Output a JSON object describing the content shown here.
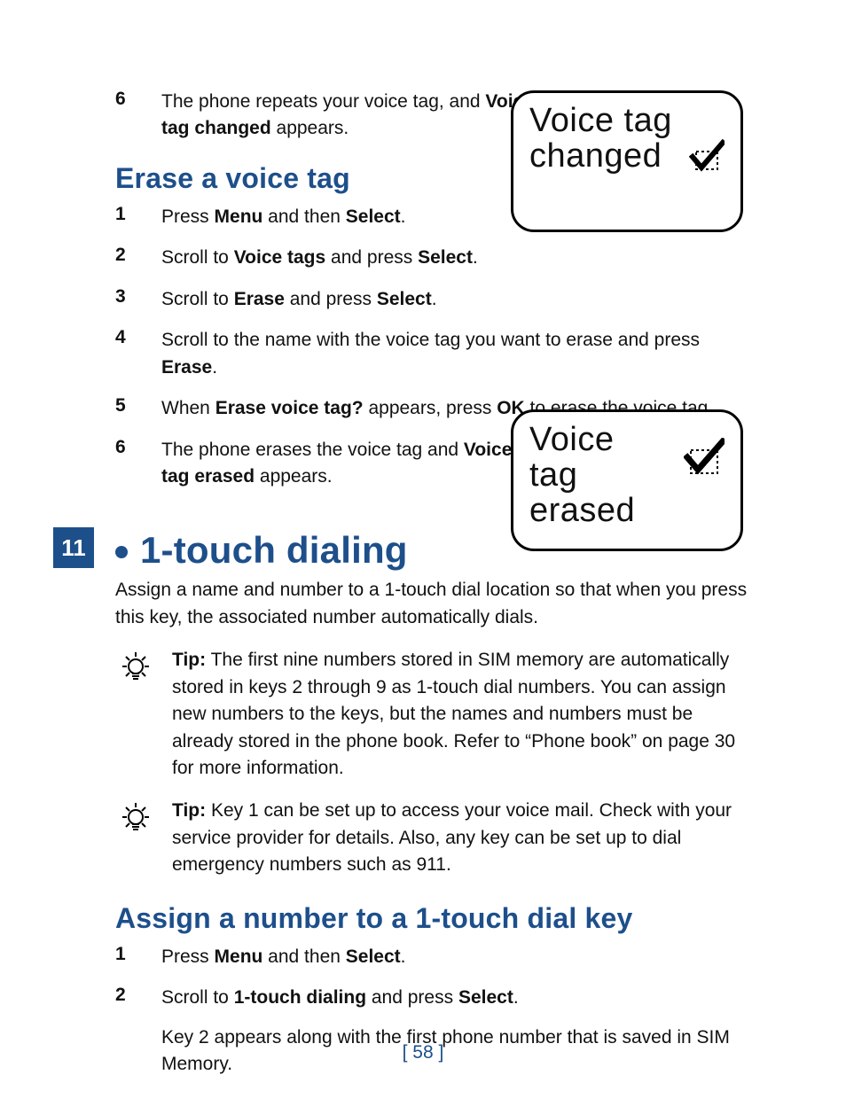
{
  "chapter_tab": "11",
  "step_pre": {
    "num": "6",
    "text_a": "The phone repeats your voice tag, and ",
    "bold": "Voice tag changed",
    "text_b": " appears."
  },
  "popup1": {
    "line1": "Voice tag",
    "line2": "changed"
  },
  "section1": {
    "title": "Erase a voice tag",
    "steps": [
      {
        "num": "1",
        "parts": [
          "Press ",
          "Menu",
          " and then ",
          "Select",
          "."
        ]
      },
      {
        "num": "2",
        "parts": [
          "Scroll to ",
          "Voice tags",
          " and press ",
          "Select",
          "."
        ]
      },
      {
        "num": "3",
        "parts": [
          "Scroll to ",
          "Erase",
          " and press ",
          "Select",
          "."
        ]
      },
      {
        "num": "4",
        "parts": [
          "Scroll to the name with the voice tag you want to erase and press ",
          "Erase",
          "."
        ]
      },
      {
        "num": "5",
        "parts": [
          "When ",
          "Erase voice tag?",
          " appears, press ",
          "OK",
          " to erase the voice tag."
        ]
      },
      {
        "num": "6",
        "parts": [
          "The phone erases the voice tag and ",
          "Voice tag erased",
          " appears."
        ]
      }
    ]
  },
  "popup2": {
    "line1": "Voice",
    "line2": "tag",
    "line3": "erased"
  },
  "topic": {
    "title": "1-touch dialing",
    "intro": "Assign a name and number to a 1-touch dial location so that when you press this key, the associated number automatically dials."
  },
  "tips": [
    {
      "label": "Tip:",
      "text": " The first nine numbers stored in SIM memory are automatically stored in keys 2 through 9 as 1-touch dial numbers. You can assign new numbers to the keys, but the names and numbers must be already stored in the phone book. Refer to “Phone book” on page 30 for more information."
    },
    {
      "label": "Tip:",
      "text": " Key 1 can be set up to access your voice mail. Check with your service provider for details. Also, any key can be set up to dial emergency numbers such as 911."
    }
  ],
  "section2": {
    "title": "Assign a number to a 1-touch dial key",
    "steps": [
      {
        "num": "1",
        "parts": [
          "Press ",
          "Menu",
          " and then ",
          "Select",
          "."
        ]
      },
      {
        "num": "2",
        "parts": [
          "Scroll to ",
          "1-touch dialing",
          " and press ",
          "Select",
          "."
        ],
        "sub": "Key 2 appears along with the first phone number that is saved in SIM Memory."
      }
    ]
  },
  "page_number": "[ 58 ]"
}
